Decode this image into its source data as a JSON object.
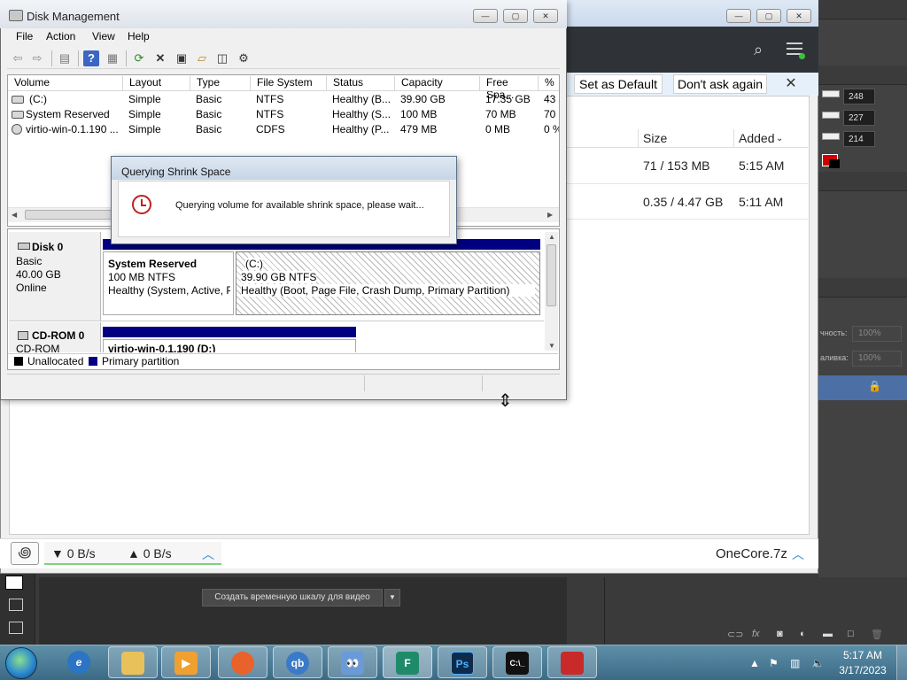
{
  "disk_management": {
    "title": "Disk Management",
    "menu": [
      "File",
      "Action",
      "View",
      "Help"
    ],
    "columns": [
      "Volume",
      "Layout",
      "Type",
      "File System",
      "Status",
      "Capacity",
      "Free Spa...",
      "% F"
    ],
    "volumes": [
      {
        "volume": "(C:)",
        "layout": "Simple",
        "type": "Basic",
        "fs": "NTFS",
        "status": "Healthy (B...",
        "capacity": "39.90 GB",
        "free": "17.35 GB",
        "pct": "43"
      },
      {
        "volume": "System Reserved",
        "layout": "Simple",
        "type": "Basic",
        "fs": "NTFS",
        "status": "Healthy (S...",
        "capacity": "100 MB",
        "free": "70 MB",
        "pct": "70"
      },
      {
        "volume": "virtio-win-0.1.190 ...",
        "layout": "Simple",
        "type": "Basic",
        "fs": "CDFS",
        "status": "Healthy (P...",
        "capacity": "479 MB",
        "free": "0 MB",
        "pct": "0 %"
      }
    ],
    "disks": [
      {
        "name": "Disk 0",
        "kind": "Basic",
        "size": "40.00 GB",
        "state": "Online"
      },
      {
        "name": "CD-ROM 0",
        "kind": "CD-ROM"
      }
    ],
    "partitions": {
      "system_reserved": {
        "title": "System Reserved",
        "size": "100 MB NTFS",
        "status": "Healthy (System, Active, P"
      },
      "c_drive": {
        "title": "(C:)",
        "size": "39.90 GB NTFS",
        "status": "Healthy (Boot, Page File, Crash Dump, Primary Partition)"
      },
      "virtio": {
        "title": "virtio-win-0.1.190 (D:)"
      }
    },
    "legend": {
      "unallocated": "Unallocated",
      "primary": "Primary partition",
      "unallocated_color": "#000000",
      "primary_color": "#000080"
    }
  },
  "dialog": {
    "title": "Querying Shrink Space",
    "message": "Querying volume for available shrink space, please wait..."
  },
  "download_manager": {
    "set_default": "Set as Default",
    "dont_ask": "Don't ask again",
    "columns": {
      "size": "Size",
      "added": "Added"
    },
    "rows": [
      {
        "size": "71 / 153 MB",
        "added": "5:15 AM"
      },
      {
        "size": "0.35 / 4.47 GB",
        "added": "5:11 AM"
      }
    ],
    "download_speed": "▼ 0 B/s",
    "upload_speed": "▲ 0 B/s",
    "current_file": "OneCore.7z",
    "accent": "#2a8ad8"
  },
  "photoshop": {
    "values": [
      "248",
      "227",
      "214"
    ],
    "pct_labels": [
      "чность:",
      "аливка:"
    ],
    "pct_values": [
      "100%",
      "100%"
    ],
    "timeline_button": "Создать временную шкалу для видео"
  },
  "taskbar": {
    "time": "5:17 AM",
    "date": "3/17/2023",
    "apps": [
      "explorer",
      "ie",
      "media",
      "firefox",
      "qbittorrent",
      "eyes",
      "download-manager",
      "photoshop",
      "cmd",
      "toolbox"
    ]
  }
}
